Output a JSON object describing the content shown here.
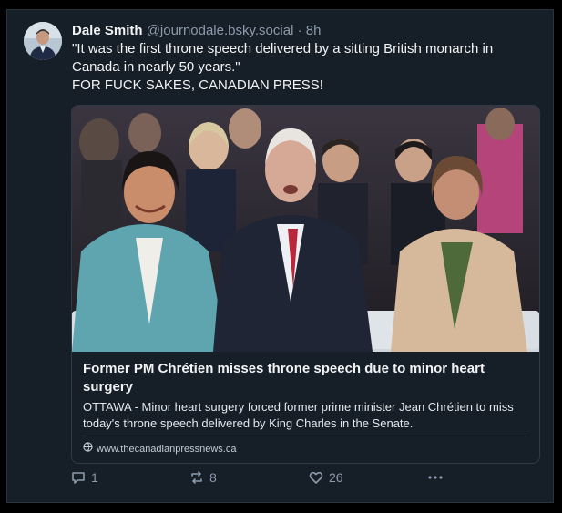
{
  "post": {
    "display_name": "Dale Smith",
    "handle": "@journodale.bsky.social",
    "separator": "·",
    "time": "8h",
    "text_lines": [
      "\"It was the first throne speech delivered by a sitting British monarch in Canada in nearly 50 years.\"",
      "FOR FUCK SAKES, CANADIAN PRESS!"
    ]
  },
  "card": {
    "title": "Former PM Chrétien misses throne speech due to minor heart surgery",
    "description": "OTTAWA - Minor heart surgery forced former prime minister Jean Chrétien to miss today's throne speech delivered by King Charles in the Senate.",
    "domain": "www.thecanadianpressnews.ca",
    "image_icon": "news-photo"
  },
  "actions": {
    "reply_count": "1",
    "repost_count": "8",
    "like_count": "26",
    "reply_icon": "reply-icon",
    "repost_icon": "repost-icon",
    "like_icon": "heart-icon",
    "more_icon": "more-icon"
  },
  "colors": {
    "background": "#161e27",
    "text": "#f1f3f5",
    "muted": "#8c9aab",
    "border": "#2f3a47"
  }
}
